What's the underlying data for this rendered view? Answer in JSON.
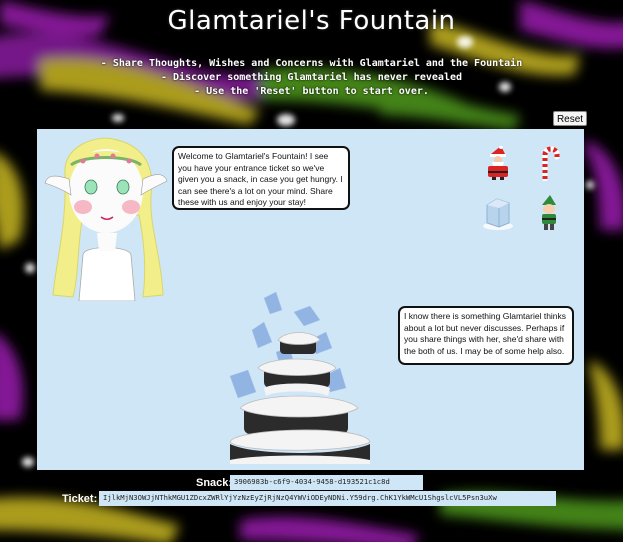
{
  "header": {
    "title": "Glamtariel's Fountain",
    "lines": [
      "- Share Thoughts, Wishes and Concerns with Glamtariel and the Fountain",
      "- Discover something Glamtariel has never revealed",
      "- Use the 'Reset' button to start over."
    ]
  },
  "reset_label": "Reset",
  "dialog": {
    "glamtariel": "Welcome to Glamtariel's Fountain! I see you have your entrance ticket so we've given you a snack, in case you get hungry. I can see there's a lot on your mind. Share these with us and enjoy your stay!",
    "fountain": "I know there is something Glamtariel thinks about a lot but never discusses. Perhaps if you share things with her, she'd share with the both of us. I may be of some help also."
  },
  "items": [
    {
      "name": "santa-icon"
    },
    {
      "name": "candy-cane-icon"
    },
    {
      "name": "ice-cube-icon"
    },
    {
      "name": "elf-icon"
    }
  ],
  "snack": {
    "label": "Snack:",
    "value": "3906983b-c6f9-4034-9458-d193521c1c8d"
  },
  "ticket": {
    "label": "Ticket:",
    "value": "IjlkMjN3OWJjNThkMGU1ZDcxZWRlYjYzNzEyZjRjNzQ4YWViODEyNDNi.Y59drg.ChK1YkWMcU1ShgslcVL5Psn3uXw"
  },
  "colors": {
    "stage_bg": "#cfe6f7",
    "page_bg": "#000000",
    "accent_purple": "#9b1fb0",
    "accent_yellow": "#c9b821",
    "accent_green": "#4f9a1e"
  }
}
